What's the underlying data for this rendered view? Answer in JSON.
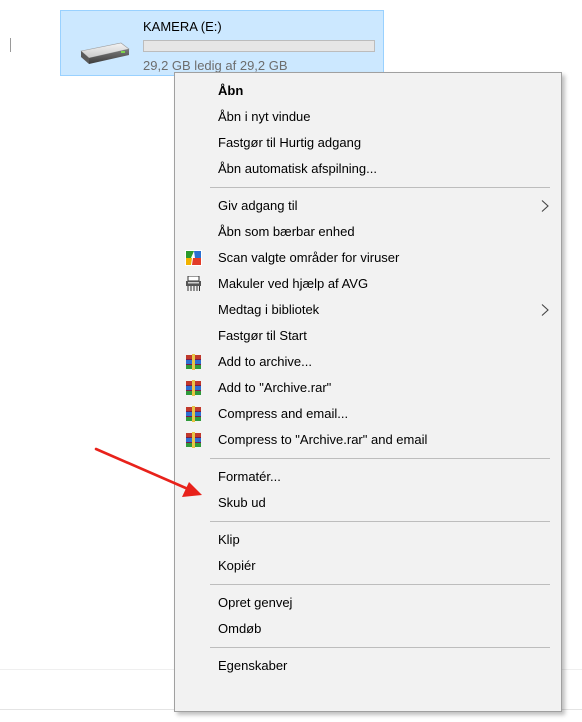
{
  "drive": {
    "name": "KAMERA (E:)",
    "free_space": "29,2 GB ledig af 29,2 GB",
    "used_fraction": 0.0
  },
  "context_menu": {
    "items": [
      {
        "label": "Åbn",
        "bold": true
      },
      {
        "label": "Åbn i nyt vindue"
      },
      {
        "label": "Fastgør til Hurtig adgang"
      },
      {
        "label": "Åbn automatisk afspilning..."
      },
      {
        "label": "Giv adgang til",
        "submenu": true
      },
      {
        "label": "Åbn som bærbar enhed"
      },
      {
        "label": "Scan valgte områder for viruser",
        "icon": "avg-scan-icon"
      },
      {
        "label": "Makuler ved hjælp af AVG",
        "icon": "shredder-icon"
      },
      {
        "label": "Medtag i bibliotek",
        "submenu": true
      },
      {
        "label": "Fastgør til Start"
      },
      {
        "label": "Add to archive...",
        "icon": "winrar-icon"
      },
      {
        "label": "Add to \"Archive.rar\"",
        "icon": "winrar-icon"
      },
      {
        "label": "Compress and email...",
        "icon": "winrar-icon"
      },
      {
        "label": "Compress to \"Archive.rar\" and email",
        "icon": "winrar-icon"
      },
      {
        "label": "Formatér..."
      },
      {
        "label": "Skub ud"
      },
      {
        "label": "Klip"
      },
      {
        "label": "Kopiér"
      },
      {
        "label": "Opret genvej"
      },
      {
        "label": "Omdøb"
      },
      {
        "label": "Egenskaber"
      }
    ]
  },
  "colors": {
    "selection": "#cce8ff",
    "menu_background": "#f2f2f2",
    "annotation": "#e8221b"
  }
}
